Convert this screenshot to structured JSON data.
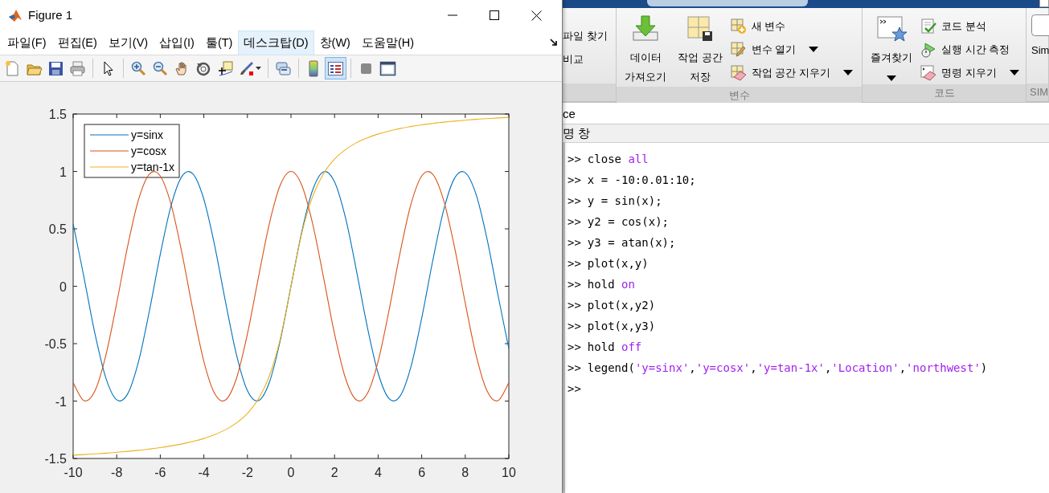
{
  "figure": {
    "title": "Figure 1",
    "menu": [
      {
        "label": "파일(F)",
        "selected": false
      },
      {
        "label": "편집(E)",
        "selected": false
      },
      {
        "label": "보기(V)",
        "selected": false
      },
      {
        "label": "삽입(I)",
        "selected": false
      },
      {
        "label": "툴(T)",
        "selected": false
      },
      {
        "label": "데스크탑(D)",
        "selected": true
      },
      {
        "label": "창(W)",
        "selected": false
      },
      {
        "label": "도움말(H)",
        "selected": false
      }
    ],
    "tools": [
      {
        "kind": "new",
        "selected": false
      },
      {
        "kind": "open",
        "selected": false
      },
      {
        "kind": "save",
        "selected": false
      },
      {
        "kind": "print",
        "selected": false
      },
      {
        "kind": "separator"
      },
      {
        "kind": "pointer",
        "selected": false
      },
      {
        "kind": "separator"
      },
      {
        "kind": "zoom-in",
        "selected": false
      },
      {
        "kind": "zoom-out",
        "selected": false
      },
      {
        "kind": "pan",
        "selected": false
      },
      {
        "kind": "rotate",
        "selected": false
      },
      {
        "kind": "datatip",
        "selected": false
      },
      {
        "kind": "brush",
        "selected": false
      },
      {
        "kind": "separator"
      },
      {
        "kind": "link",
        "selected": false
      },
      {
        "kind": "separator"
      },
      {
        "kind": "colorbar",
        "selected": false
      },
      {
        "kind": "legend",
        "selected": true
      },
      {
        "kind": "separator"
      },
      {
        "kind": "hide",
        "selected": false
      },
      {
        "kind": "dock",
        "selected": false
      }
    ],
    "chart_data": {
      "type": "line",
      "x": [
        -10,
        -9.5,
        -9,
        -8.5,
        -8,
        -7.5,
        -7,
        -6.5,
        -6,
        -5.5,
        -5,
        -4.5,
        -4,
        -3.5,
        -3,
        -2.5,
        -2,
        -1.5,
        -1,
        -0.5,
        0,
        0.5,
        1,
        1.5,
        2,
        2.5,
        3,
        3.5,
        4,
        4.5,
        5,
        5.5,
        6,
        6.5,
        7,
        7.5,
        8,
        8.5,
        9,
        9.5,
        10
      ],
      "series": [
        {
          "name": "y=sinx",
          "color": "#0072bd",
          "values": [
            0.544,
            0.075,
            -0.412,
            -0.798,
            -0.989,
            -0.938,
            -0.657,
            -0.215,
            0.279,
            0.706,
            0.959,
            0.978,
            0.757,
            0.351,
            -0.141,
            -0.598,
            -0.909,
            -0.997,
            -0.841,
            -0.479,
            0,
            0.479,
            0.841,
            0.997,
            0.909,
            0.598,
            0.141,
            -0.351,
            -0.757,
            -0.978,
            -0.959,
            -0.706,
            -0.279,
            0.215,
            0.657,
            0.938,
            0.989,
            0.798,
            0.412,
            -0.075,
            -0.544
          ]
        },
        {
          "name": "y=cosx",
          "color": "#d95319",
          "values": [
            -0.839,
            -0.997,
            -0.911,
            -0.602,
            -0.146,
            0.347,
            0.754,
            0.977,
            0.96,
            0.709,
            0.284,
            -0.211,
            -0.654,
            -0.936,
            -0.99,
            -0.801,
            -0.416,
            0.071,
            0.54,
            0.878,
            1,
            0.878,
            0.54,
            0.071,
            -0.416,
            -0.801,
            -0.99,
            -0.936,
            -0.654,
            -0.211,
            0.284,
            0.709,
            0.96,
            0.977,
            0.754,
            0.347,
            -0.146,
            -0.602,
            -0.911,
            -0.997,
            -0.839
          ]
        },
        {
          "name": "y=tan-1x",
          "color": "#edb120",
          "values": [
            -1.471,
            -1.466,
            -1.46,
            -1.454,
            -1.446,
            -1.438,
            -1.429,
            -1.418,
            -1.406,
            -1.391,
            -1.373,
            -1.352,
            -1.326,
            -1.292,
            -1.249,
            -1.19,
            -1.107,
            -0.983,
            -0.785,
            -0.464,
            0,
            0.464,
            0.785,
            0.983,
            1.107,
            1.19,
            1.249,
            1.292,
            1.326,
            1.352,
            1.373,
            1.391,
            1.406,
            1.418,
            1.429,
            1.438,
            1.446,
            1.454,
            1.46,
            1.466,
            1.471
          ]
        }
      ],
      "xlim": [
        -10,
        10
      ],
      "ylim": [
        -1.5,
        1.5
      ],
      "xticks": [
        -10,
        -8,
        -6,
        -4,
        -2,
        0,
        2,
        4,
        6,
        8,
        10
      ],
      "yticks": [
        -1.5,
        -1,
        -0.5,
        0,
        0.5,
        1,
        1.5
      ],
      "legend": true
    }
  },
  "ribbon": {
    "groups": [
      {
        "items": [
          {
            "kind": "plain",
            "label": "파일 찾기"
          },
          {
            "kind": "plain",
            "label": "비교"
          }
        ]
      },
      {
        "label": "변수",
        "items": [
          {
            "kind": "large",
            "label": "데이터\n가져오기",
            "dropdown": false
          },
          {
            "kind": "large",
            "label": "작업 공간\n저장",
            "dropdown": false
          },
          {
            "kind": "small",
            "label": "새 변수",
            "dropdown": false
          },
          {
            "kind": "small",
            "label": "변수 열기",
            "dropdown": true
          },
          {
            "kind": "small",
            "label": "작업 공간 지우기",
            "dropdown": true
          }
        ]
      },
      {
        "label": "코드",
        "items": [
          {
            "kind": "large",
            "label": "즐겨찾기",
            "dropdown": true
          },
          {
            "kind": "small",
            "label": "코드 분석",
            "dropdown": false
          },
          {
            "kind": "small",
            "label": "실행 시간 측정",
            "dropdown": false
          },
          {
            "kind": "small",
            "label": "명령 지우기",
            "dropdown": true
          }
        ]
      },
      {
        "label": "SIM",
        "items": [
          {
            "kind": "large",
            "label": "Sim",
            "dropdown": false
          }
        ]
      }
    ]
  },
  "address": "ce",
  "panel_title": "명 창",
  "command_lines": [
    {
      "prompt": ">>",
      "parts": [
        {
          "kind": "code",
          "text": "close "
        },
        {
          "kind": "string",
          "text": "all"
        }
      ]
    },
    {
      "prompt": ">>",
      "parts": [
        {
          "kind": "code",
          "text": "x = -10:0.01:10;"
        }
      ]
    },
    {
      "prompt": ">>",
      "parts": [
        {
          "kind": "code",
          "text": "y = sin(x);"
        }
      ]
    },
    {
      "prompt": ">>",
      "parts": [
        {
          "kind": "code",
          "text": "y2 = cos(x);"
        }
      ]
    },
    {
      "prompt": ">>",
      "parts": [
        {
          "kind": "code",
          "text": "y3 = atan(x);"
        }
      ]
    },
    {
      "prompt": ">>",
      "parts": [
        {
          "kind": "code",
          "text": "plot(x,y)"
        }
      ]
    },
    {
      "prompt": ">>",
      "parts": [
        {
          "kind": "code",
          "text": "hold "
        },
        {
          "kind": "string",
          "text": "on"
        }
      ]
    },
    {
      "prompt": ">>",
      "parts": [
        {
          "kind": "code",
          "text": "plot(x,y2)"
        }
      ]
    },
    {
      "prompt": ">>",
      "parts": [
        {
          "kind": "code",
          "text": "plot(x,y3)"
        }
      ]
    },
    {
      "prompt": ">>",
      "parts": [
        {
          "kind": "code",
          "text": "hold "
        },
        {
          "kind": "string",
          "text": "off"
        }
      ]
    },
    {
      "prompt": ">>",
      "parts": [
        {
          "kind": "code",
          "text": "legend("
        },
        {
          "kind": "string",
          "text": "'y=sinx'"
        },
        {
          "kind": "code",
          "text": ","
        },
        {
          "kind": "string",
          "text": "'y=cosx'"
        },
        {
          "kind": "code",
          "text": ","
        },
        {
          "kind": "string",
          "text": "'y=tan-1x'"
        },
        {
          "kind": "code",
          "text": ","
        },
        {
          "kind": "string",
          "text": "'Location'"
        },
        {
          "kind": "code",
          "text": ","
        },
        {
          "kind": "string",
          "text": "'northwest'"
        },
        {
          "kind": "code",
          "text": ")"
        }
      ]
    },
    {
      "prompt": ">>"
    }
  ]
}
